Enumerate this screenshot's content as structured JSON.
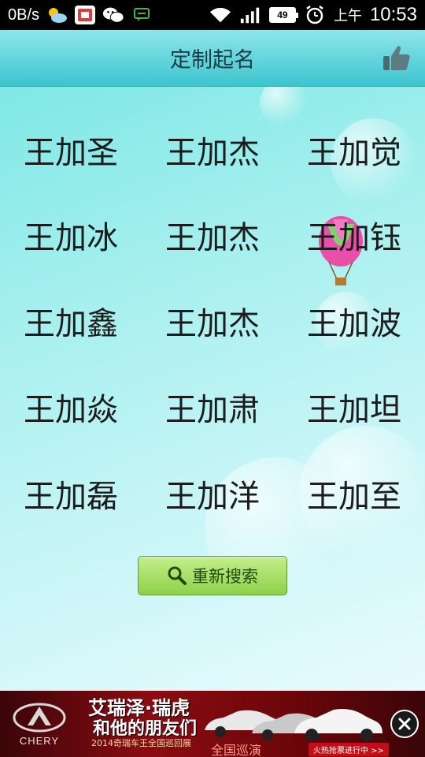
{
  "status_bar": {
    "net_speed": "0B/s",
    "battery_level": "49",
    "ampm": "上午",
    "time": "10:53"
  },
  "header": {
    "title": "定制起名"
  },
  "names": [
    "王加圣",
    "王加杰",
    "王加觉",
    "王加冰",
    "王加杰",
    "王加钰",
    "王加鑫",
    "王加杰",
    "王加波",
    "王加焱",
    "王加肃",
    "王加坦",
    "王加磊",
    "王加洋",
    "王加至"
  ],
  "actions": {
    "search_again_label": "重新搜索"
  },
  "ad": {
    "logo_text": "CHERY",
    "headline_1": "艾瑞泽·瑞虎",
    "headline_2": "和他的朋友们",
    "subline": "2014奇瑞车王全国巡回展",
    "tour": "全国巡演",
    "cta": "火热抢票进行中 >>"
  },
  "colors": {
    "header_top": "#8fe6ea",
    "header_bottom": "#3cc4cf",
    "button_green": "#8ed14b",
    "ad_red": "#8b0c12"
  }
}
